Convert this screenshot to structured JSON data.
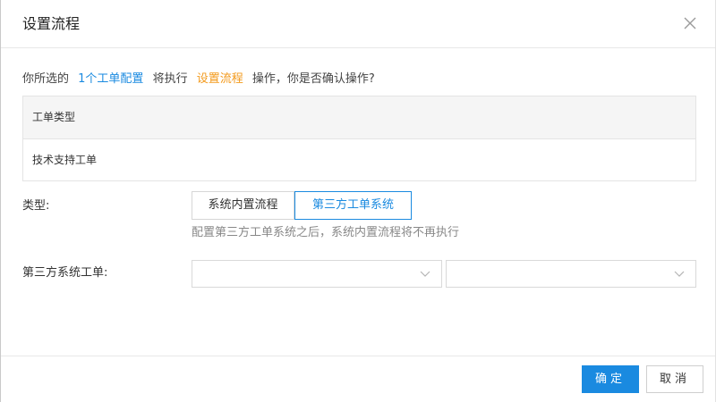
{
  "dialog": {
    "title": "设置流程",
    "close_icon": "close-icon"
  },
  "confirm": {
    "prefix": "你所选的",
    "selection": "1个工单配置",
    "middle": "将执行",
    "action": "设置流程",
    "suffix": "操作，你是否确认操作?"
  },
  "table": {
    "header": "工单类型",
    "rows": [
      "技术支持工单"
    ]
  },
  "form": {
    "type_label": "类型:",
    "type_options": [
      "系统内置流程",
      "第三方工单系统"
    ],
    "type_selected": "第三方工单系统",
    "hint": "配置第三方工单系统之后，系统内置流程将不再执行",
    "third_label": "第三方系统工单:",
    "select1_value": "",
    "select2_value": "",
    "select_icon": "chevron-down-icon"
  },
  "footer": {
    "ok_label": "确定",
    "cancel_label": "取消"
  },
  "colors": {
    "accent": "#1a8ae0",
    "highlight": "#f39a1c"
  }
}
